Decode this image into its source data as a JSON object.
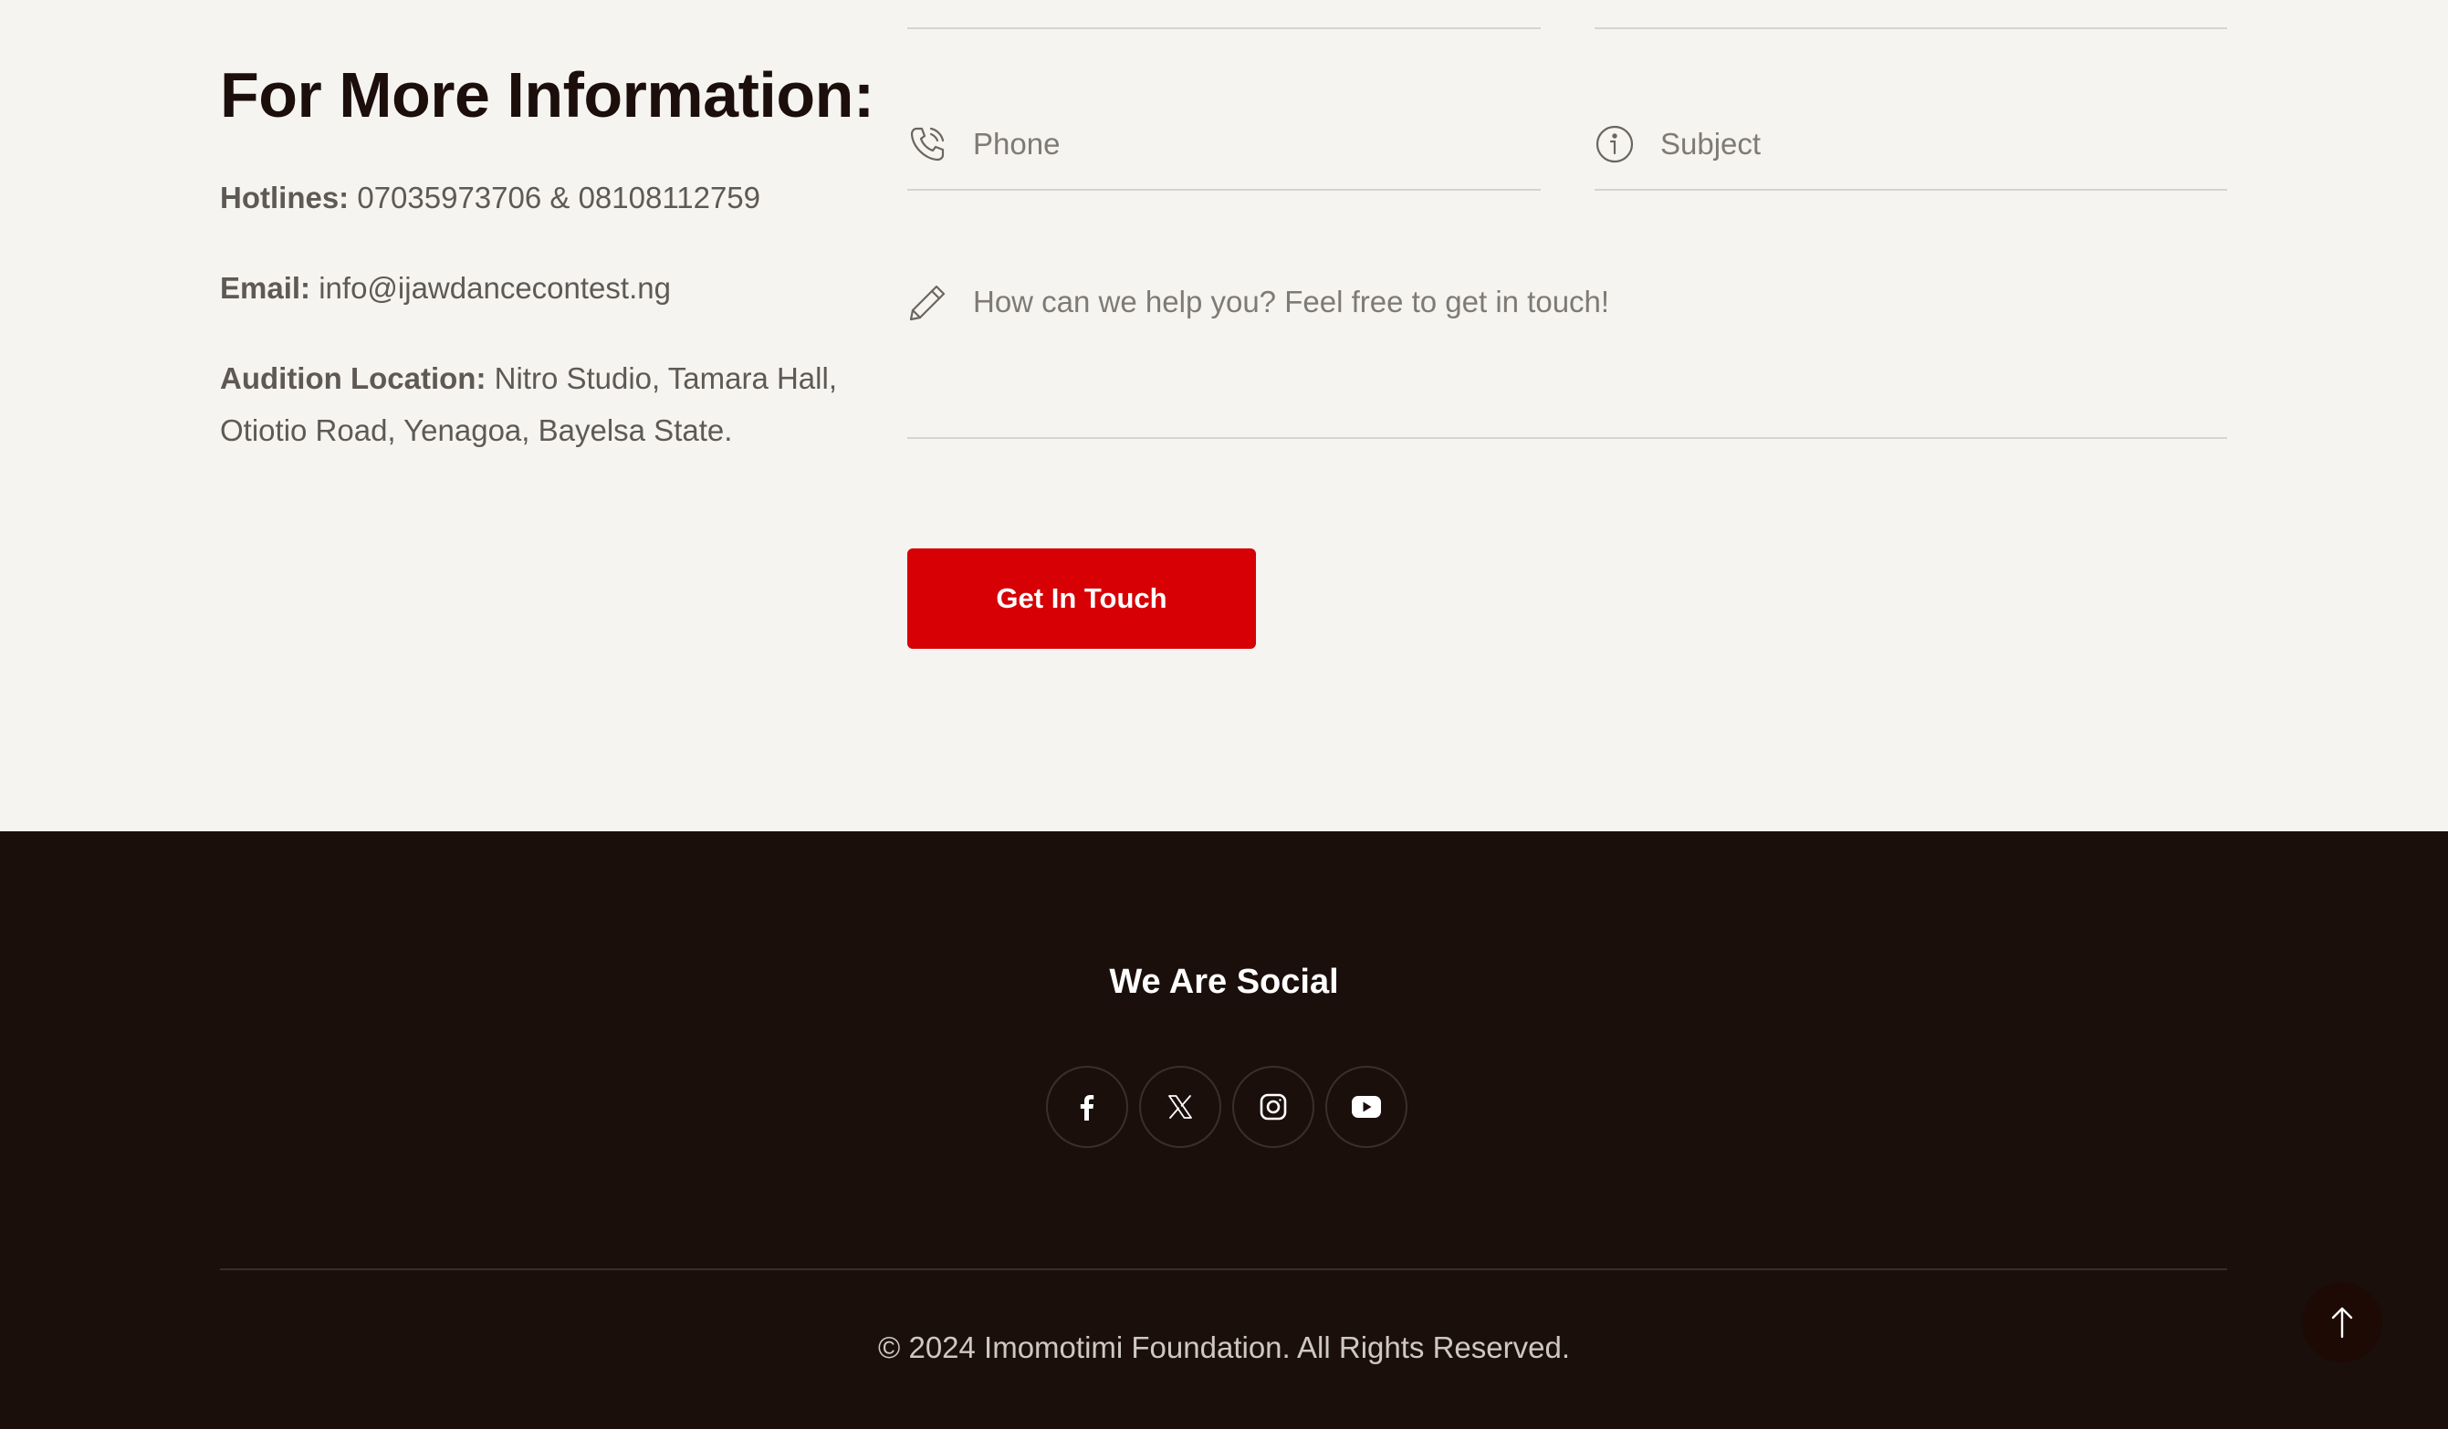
{
  "info": {
    "heading": "For More Information:",
    "hotlines_label": "Hotlines:",
    "hotlines_value": " 07035973706 & 08108112759",
    "email_label": "Email:",
    "email_value": " info@ijawdancecontest.ng",
    "location_label": "Audition Location:",
    "location_value": " Nitro Studio, Tamara Hall, Otiotio Road, Yenagoa, Bayelsa State."
  },
  "form": {
    "phone_placeholder": "Phone",
    "phone_icon": "phone-icon",
    "subject_placeholder": "Subject",
    "subject_icon": "info-icon",
    "message_placeholder": "How can we help you? Feel free to get in touch!",
    "message_icon": "pencil-icon",
    "submit_label": "Get In Touch"
  },
  "footer": {
    "social_heading": "We Are Social",
    "socials": [
      "facebook-icon",
      "x-icon",
      "instagram-icon",
      "youtube-icon"
    ],
    "copyright": "© 2024 Imomotimi Foundation. All Rights Reserved.",
    "back_to_top_icon": "arrow-up-icon"
  },
  "colors": {
    "background": "#f5f4f0",
    "heading": "#1b0e0b",
    "accent": "#d60005",
    "footer_bg": "#1a0f0b"
  }
}
